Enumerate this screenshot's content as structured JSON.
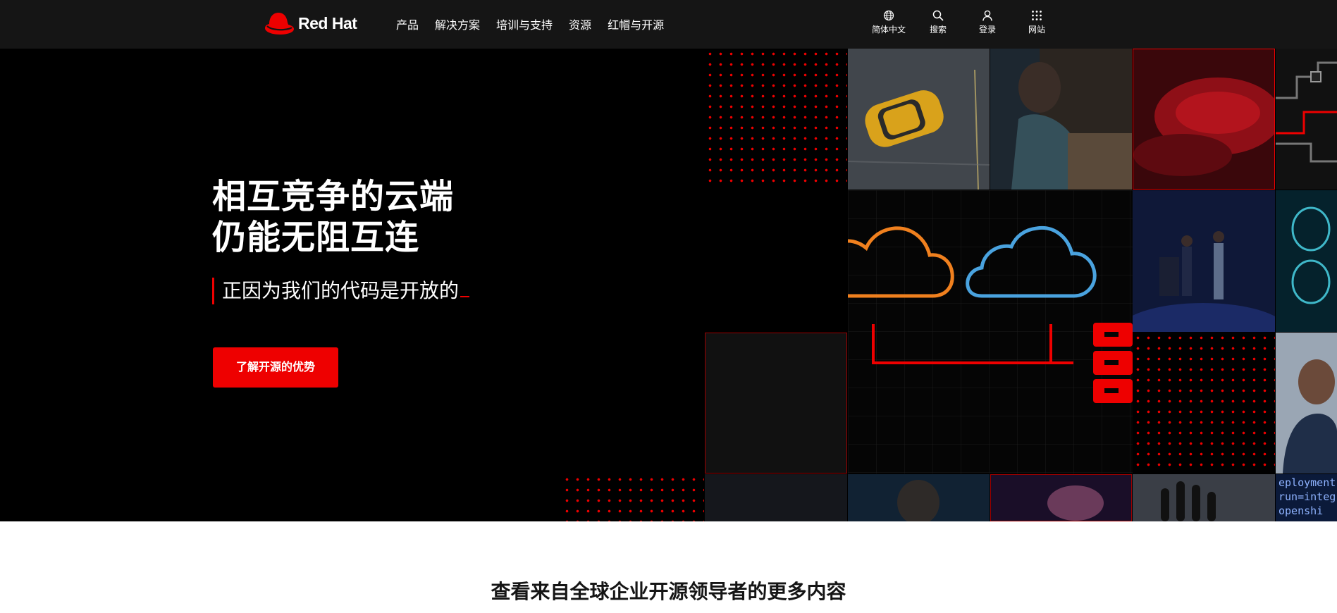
{
  "brand": {
    "name": "Red Hat",
    "logo_color": "#ee0000"
  },
  "nav": {
    "items": [
      "产品",
      "解决方案",
      "培训与支持",
      "资源",
      "红帽与开源"
    ]
  },
  "utility_nav": [
    {
      "label": "简体中文",
      "icon": "globe-icon"
    },
    {
      "label": "搜索",
      "icon": "search-icon"
    },
    {
      "label": "登录",
      "icon": "user-icon"
    },
    {
      "label": "网站",
      "icon": "grid-icon"
    }
  ],
  "hero": {
    "title_line1": "相互竞争的云端",
    "title_line2": "仍能无阻互连",
    "typed_text": "正因为我们的代码是开放的",
    "cta_label": "了解开源的优势"
  },
  "mosaic": {
    "code_snippet": [
      "eployment",
      "run=integ",
      "openshi"
    ]
  },
  "section": {
    "heading": "查看来自全球企业开源领导者的更多内容"
  },
  "colors": {
    "accent": "#ee0000",
    "header_bg": "#151515",
    "hero_bg": "#000000",
    "cloud_orange": "#f0801e",
    "cloud_blue": "#4aa3df"
  }
}
